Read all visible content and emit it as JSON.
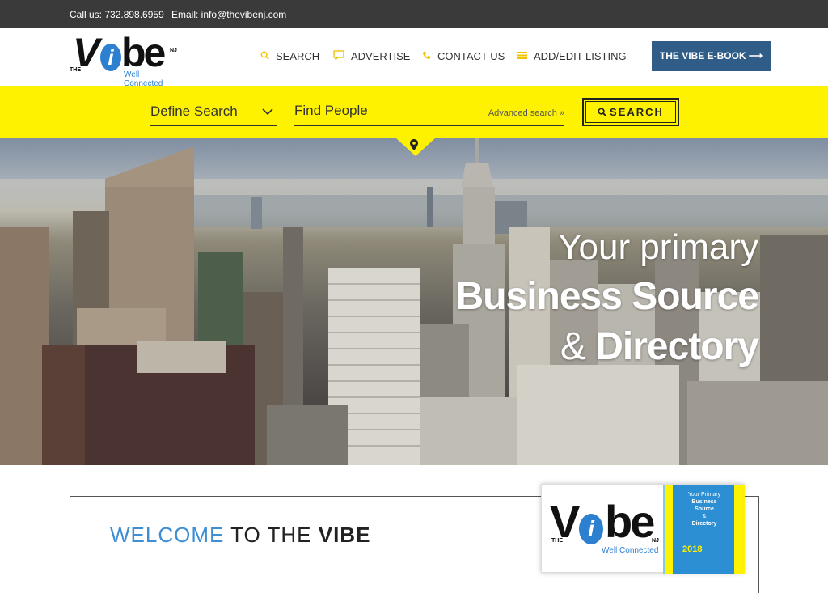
{
  "topbar": {
    "phone": "Call us: 732.898.6959",
    "email": "Email: info@thevibenj.com"
  },
  "logo": {
    "the": "THE",
    "v": "V",
    "i": "i",
    "be": "be",
    "nj": "NJ",
    "tagline": "Well Connected"
  },
  "nav": {
    "search": "SEARCH",
    "advertise": "ADVERTISE",
    "contact": "CONTACT US",
    "add_edit": "ADD/EDIT LISTING",
    "ebook": "THE VIBE E-BOOK ⟶"
  },
  "searchbar": {
    "define_label": "Define Search",
    "find_placeholder": "Find People",
    "advanced": "Advanced search »",
    "button": "SEARCH"
  },
  "hero": {
    "line1": "Your primary",
    "line2": "Business Source",
    "line3_amp": "& ",
    "line3": "Directory"
  },
  "welcome": {
    "part1": "WELCOME ",
    "part2": "TO THE ",
    "part3": "VIBE"
  },
  "book": {
    "the": "THE",
    "v": "V",
    "i": "i",
    "be": "be",
    "nj": "NJ",
    "tagline": "Well Connected",
    "blurb_small": "Your Primary",
    "blurb_1": "Business",
    "blurb_2": "Source",
    "blurb_amp": "&",
    "blurb_3": "Directory",
    "year": "2018"
  },
  "colors": {
    "accent_yellow": "#fef200",
    "brand_blue": "#2d7fd0",
    "button_blue": "#2f5d87",
    "topbar": "#3a3a3a"
  }
}
